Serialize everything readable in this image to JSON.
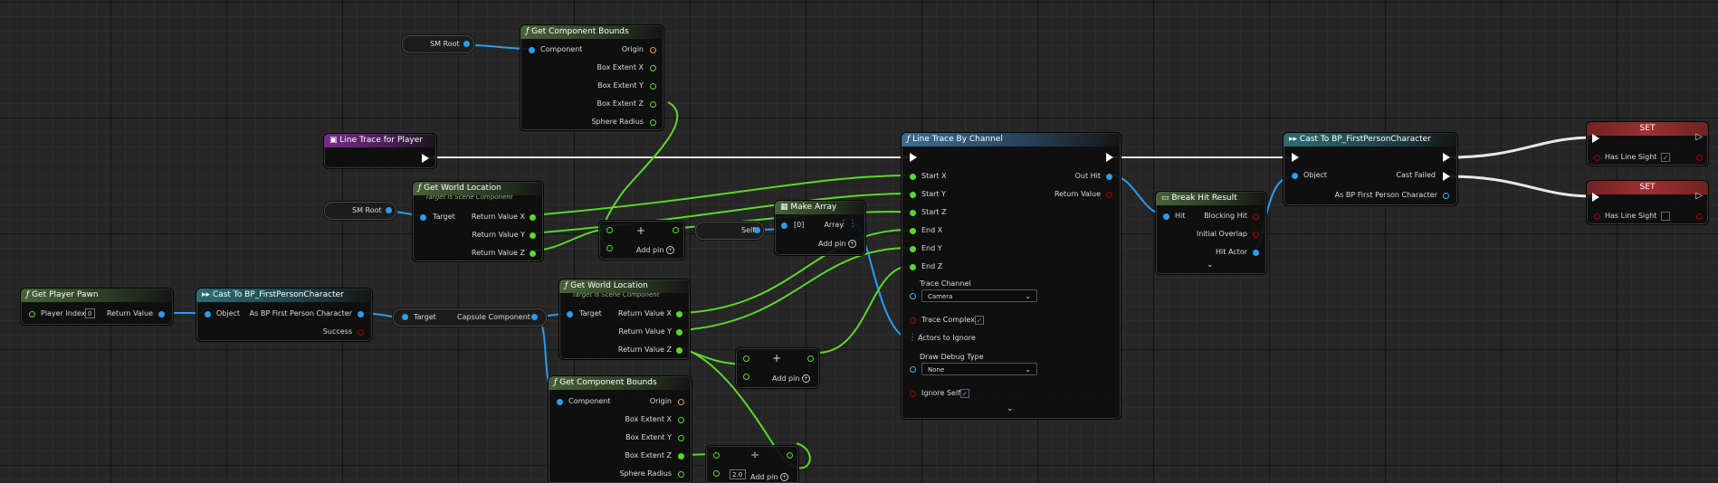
{
  "nodes": {
    "sm_root_top": {
      "label": "SM Root"
    },
    "bounds_top": {
      "title": "Get Component Bounds",
      "component": "Component",
      "origin": "Origin",
      "box_x": "Box Extent X",
      "box_y": "Box Extent Y",
      "box_z": "Box Extent Z",
      "radius": "Sphere Radius"
    },
    "line_trace_event": {
      "title": "Line Trace for Player"
    },
    "sm_root_mid": {
      "label": "SM Root"
    },
    "world_loc_top": {
      "title": "Get World Location",
      "subtitle": "Target is Scene Component",
      "target": "Target",
      "rx": "Return Value X",
      "ry": "Return Value Y",
      "rz": "Return Value Z"
    },
    "add_top": {
      "label": "Add pin"
    },
    "self_node": {
      "label": "Self"
    },
    "make_array": {
      "title": "Make Array",
      "index": "[0]",
      "array": "Array",
      "add": "Add pin"
    },
    "get_player_pawn": {
      "title": "Get Player Pawn",
      "player_index": "Player Index",
      "index_value": "0",
      "ret": "Return Value"
    },
    "cast_left": {
      "title": "Cast To BP_FirstPersonCharacter",
      "object": "Object",
      "as_bp": "As BP First Person Character",
      "success": "Success"
    },
    "capsule_get": {
      "target": "Target",
      "capsule": "Capsule Component"
    },
    "world_loc_bottom": {
      "title": "Get World Location",
      "subtitle": "Target is Scene Component",
      "target": "Target",
      "rx": "Return Value X",
      "ry": "Return Value Y",
      "rz": "Return Value Z"
    },
    "add_bottom": {
      "label": "Add pin"
    },
    "bounds_bottom": {
      "title": "Get Component Bounds",
      "component": "Component",
      "origin": "Origin",
      "box_x": "Box Extent X",
      "box_y": "Box Extent Y",
      "box_z": "Box Extent Z",
      "radius": "Sphere Radius"
    },
    "divide": {
      "value": "2.0",
      "add": "Add pin"
    },
    "line_trace": {
      "title": "Line Trace By Channel",
      "start_x": "Start X",
      "start_y": "Start Y",
      "start_z": "Start Z",
      "end_x": "End X",
      "end_y": "End Y",
      "end_z": "End Z",
      "trace_channel": "Trace Channel",
      "channel_value": "Camera",
      "trace_complex": "Trace Complex",
      "actors_ignore": "Actors to Ignore",
      "draw_debug": "Draw Debug Type",
      "debug_value": "None",
      "ignore_self": "Ignore Self",
      "out_hit": "Out Hit",
      "ret": "Return Value"
    },
    "break_hit": {
      "title": "Break Hit Result",
      "hit": "Hit",
      "blocking": "Blocking Hit",
      "initial": "Initial Overlap",
      "actor": "Hit Actor"
    },
    "cast_right": {
      "title": "Cast To BP_FirstPersonCharacter",
      "object": "Object",
      "failed": "Cast Failed",
      "as_bp": "As BP First Person Character"
    },
    "set_top": {
      "title": "SET",
      "var": "Has Line Sight",
      "checked": "✓"
    },
    "set_bottom": {
      "title": "SET",
      "var": "Has Line Sight"
    }
  },
  "colors": {
    "exec": "#ffffff",
    "object": "#2b9cf0",
    "float": "#5bd82b",
    "bool": "#a00000",
    "vector": "#e3a22b"
  }
}
